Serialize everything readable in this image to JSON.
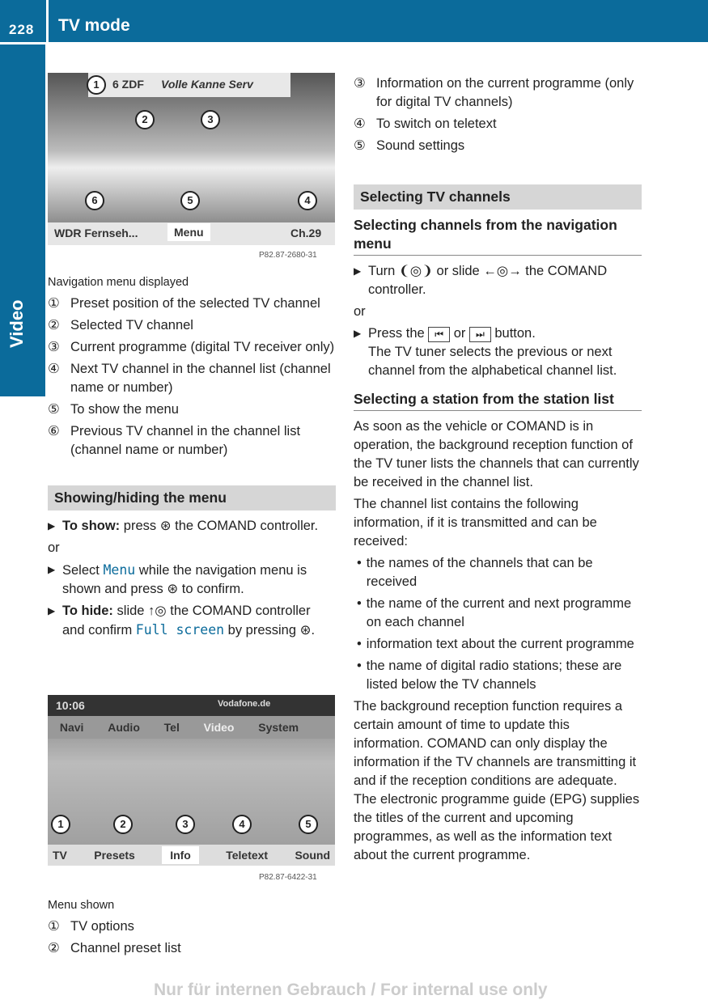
{
  "header": {
    "page_number": "228",
    "title": "TV mode",
    "side_tab": "Video"
  },
  "figure1": {
    "channel": "6 ZDF",
    "programme": "Volle Kanne Serv",
    "prev": "WDR Fernseh...",
    "menu": "Menu",
    "next_channel": "Ch.29",
    "code": "P82.87-2680-31",
    "callouts": [
      "1",
      "2",
      "3",
      "4",
      "5",
      "6"
    ]
  },
  "left": {
    "caption1": "Navigation menu displayed",
    "list1": [
      {
        "n": "①",
        "t": "Preset position of the selected TV channel"
      },
      {
        "n": "②",
        "t": "Selected TV channel"
      },
      {
        "n": "③",
        "t": "Current programme (digital TV receiver only)"
      },
      {
        "n": "④",
        "t": "Next TV channel in the channel list (channel name or number)"
      },
      {
        "n": "⑤",
        "t": "To show the menu"
      },
      {
        "n": "⑥",
        "t": "Previous TV channel in the channel list (channel name or number)"
      }
    ],
    "section": "Showing/hiding the menu",
    "show_b": "To show:",
    "show_t": " press ⊛ the COMAND controller.",
    "or": "or",
    "select_a": "Select ",
    "select_menu": "Menu",
    "select_b": " while the navigation menu is shown and press ⊛ to confirm.",
    "hide_b": "To hide:",
    "hide_a": " slide ↑◎ the COMAND controller and confirm ",
    "hide_fs": "Full screen",
    "hide_c": " by pressing ⊛.",
    "caption2": "Menu shown",
    "list2": [
      {
        "n": "①",
        "t": "TV options"
      },
      {
        "n": "②",
        "t": "Channel preset list"
      }
    ]
  },
  "figure2": {
    "time": "10:06",
    "provider": "Vodafone.de",
    "menu": [
      "Navi",
      "Audio",
      "Tel",
      "Video",
      "System"
    ],
    "bottom": [
      "TV",
      "Presets",
      "Info",
      "Teletext",
      "Sound"
    ],
    "code": "P82.87-6422-31"
  },
  "right": {
    "list": [
      {
        "n": "③",
        "t": "Information on the current programme (only for digital TV channels)"
      },
      {
        "n": "④",
        "t": "To switch on teletext"
      },
      {
        "n": "⑤",
        "t": "Sound settings"
      }
    ],
    "section": "Selecting TV channels",
    "sub1": "Selecting channels from the navigation menu",
    "turn": "Turn ❨◎❩ or slide ←◎→ the COMAND controller.",
    "or": "or",
    "press_a": "Press the ",
    "key_prev": "⏮",
    "press_or": " or ",
    "key_next": "⏭",
    "press_b": " button.",
    "press_desc": "The TV tuner selects the previous or next channel from the alphabetical channel list.",
    "sub2": "Selecting a station from the station list",
    "p1": "As soon as the vehicle or COMAND is in operation, the background reception function of the TV tuner lists the channels that can currently be received in the channel list.",
    "p2": "The channel list contains the following information, if it is transmitted and can be received:",
    "bullets": [
      "the names of the channels that can be received",
      "the name of the current and next programme on each channel",
      "information text about the current programme",
      "the name of digital radio stations; these are listed below the TV channels"
    ],
    "p3": "The background reception function requires a certain amount of time to update this information. COMAND can only display the information if the TV channels are transmitting it and if the reception conditions are adequate. The electronic programme guide (EPG) supplies the titles of the current and upcoming programmes, as well as the information text about the current programme."
  },
  "watermark": "Nur für internen Gebrauch / For internal use only"
}
